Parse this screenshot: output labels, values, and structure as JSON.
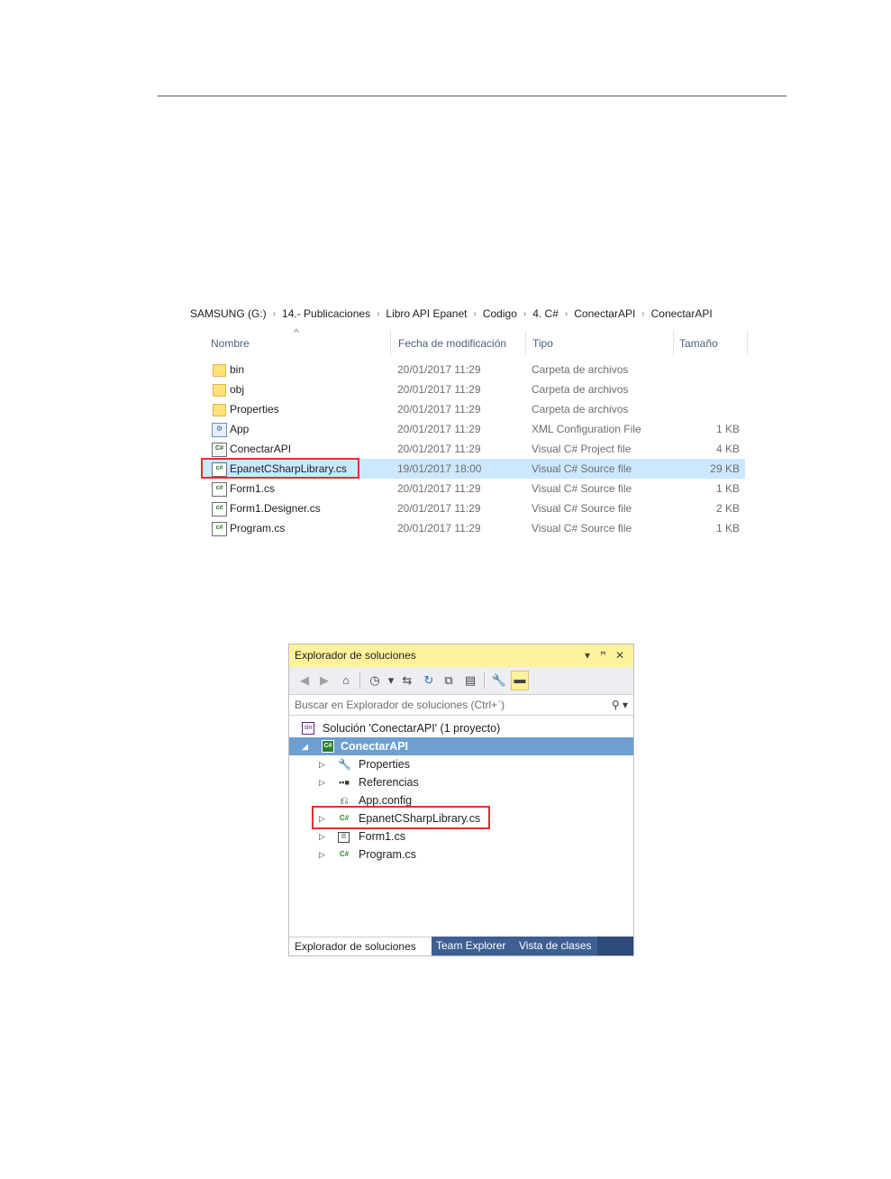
{
  "explorer": {
    "breadcrumb": [
      "SAMSUNG (G:)",
      "14.- Publicaciones",
      "Libro API Epanet",
      "Codigo",
      "4. C#",
      "ConectarAPI",
      "ConectarAPI"
    ],
    "breadcrumb_sep": "›",
    "columns": {
      "name": "Nombre",
      "date": "Fecha de modificación",
      "type": "Tipo",
      "size": "Tamaño"
    },
    "rows": [
      {
        "name": "bin",
        "date": "20/01/2017 11:29",
        "type": "Carpeta de archivos",
        "size": "",
        "icon": "folder-icon"
      },
      {
        "name": "obj",
        "date": "20/01/2017 11:29",
        "type": "Carpeta de archivos",
        "size": "",
        "icon": "folder-icon"
      },
      {
        "name": "Properties",
        "date": "20/01/2017 11:29",
        "type": "Carpeta de archivos",
        "size": "",
        "icon": "folder-icon"
      },
      {
        "name": "App",
        "date": "20/01/2017 11:29",
        "type": "XML Configuration File",
        "size": "1 KB",
        "icon": "config-file-icon"
      },
      {
        "name": "ConectarAPI",
        "date": "20/01/2017 11:29",
        "type": "Visual C# Project file",
        "size": "4 KB",
        "icon": "csharp-project-icon"
      },
      {
        "name": "EpanetCSharpLibrary.cs",
        "date": "19/01/2017 18:00",
        "type": "Visual C# Source file",
        "size": "29 KB",
        "icon": "csharp-file-icon",
        "selected": true
      },
      {
        "name": "Form1.cs",
        "date": "20/01/2017 11:29",
        "type": "Visual C# Source file",
        "size": "1 KB",
        "icon": "csharp-file-icon"
      },
      {
        "name": "Form1.Designer.cs",
        "date": "20/01/2017 11:29",
        "type": "Visual C# Source file",
        "size": "2 KB",
        "icon": "csharp-file-icon"
      },
      {
        "name": "Program.cs",
        "date": "20/01/2017 11:29",
        "type": "Visual C# Source file",
        "size": "1 KB",
        "icon": "csharp-file-icon"
      }
    ]
  },
  "solution_explorer": {
    "title": "Explorador de soluciones",
    "search_placeholder": "Buscar en Explorador de soluciones (Ctrl+`)",
    "tree": {
      "solution": "Solución 'ConectarAPI' (1 proyecto)",
      "project": "ConectarAPI",
      "properties": "Properties",
      "references": "Referencias",
      "app_config": "App.config",
      "library": "EpanetCSharpLibrary.cs",
      "form": "Form1.cs",
      "program": "Program.cs"
    },
    "tabs": [
      "Explorador de soluciones",
      "Team Explorer",
      "Vista de clases"
    ],
    "colors": {
      "title_bar": "#fff29d",
      "selection": "#6d9fd2",
      "tab_strip": "#2e4a78",
      "highlight_box": "#e03030"
    }
  }
}
